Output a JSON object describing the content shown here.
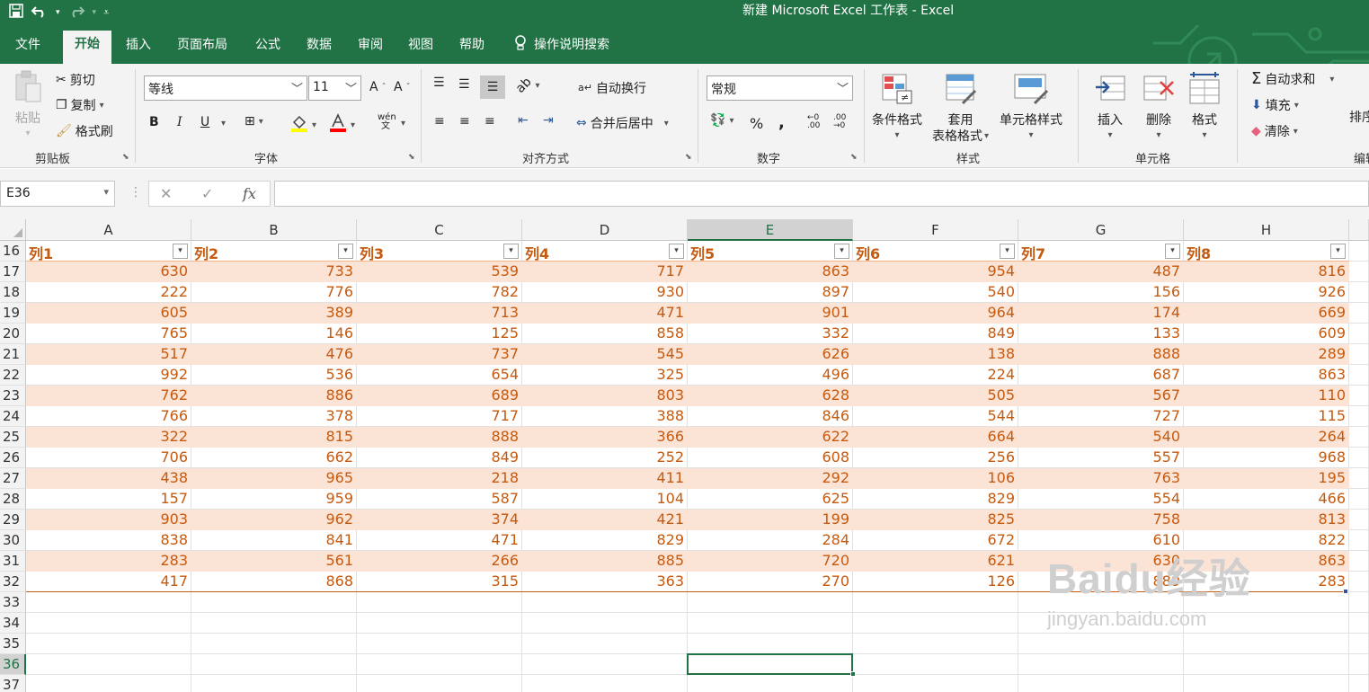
{
  "title": "新建 Microsoft Excel 工作表  -  Excel",
  "qat": {
    "save_icon": "save-icon",
    "undo_icon": "undo-icon",
    "redo_icon": "redo-icon",
    "customize_icon": "customize-icon"
  },
  "tabs": [
    {
      "label": "文件"
    },
    {
      "label": "开始"
    },
    {
      "label": "插入"
    },
    {
      "label": "页面布局"
    },
    {
      "label": "公式"
    },
    {
      "label": "数据"
    },
    {
      "label": "审阅"
    },
    {
      "label": "视图"
    },
    {
      "label": "帮助"
    },
    {
      "label": "操作说明搜索"
    }
  ],
  "ribbon": {
    "clipboard": {
      "paste": "粘贴",
      "cut": "剪切",
      "copy": "复制",
      "format_painter": "格式刷",
      "label": "剪贴板"
    },
    "font": {
      "name": "等线",
      "size": "11",
      "bold": "B",
      "italic": "I",
      "underline": "U",
      "grow": "A",
      "shrink": "A",
      "phonetic": "wén 文",
      "label": "字体"
    },
    "alignment": {
      "wrap": "自动换行",
      "merge": "合并后居中",
      "label": "对齐方式"
    },
    "number": {
      "format": "常规",
      "percent": "%",
      "comma": ",",
      "label": "数字"
    },
    "styles": {
      "conditional": "条件格式",
      "table_1": "套用",
      "table_2": "表格格式",
      "cell_styles": "单元格样式",
      "label": "样式"
    },
    "cells": {
      "insert": "插入",
      "delete": "删除",
      "format": "格式",
      "label": "单元格"
    },
    "editing": {
      "autosum": "自动求和",
      "fill": "填充",
      "clear": "清除",
      "sort": "排序",
      "label": "编辑"
    }
  },
  "formula_bar": {
    "name_box": "E36",
    "cancel": "✕",
    "enter": "✓",
    "fx": "fx",
    "value": ""
  },
  "columns": [
    "A",
    "B",
    "C",
    "D",
    "E",
    "F",
    "G",
    "H"
  ],
  "selected_column": "E",
  "selected_row": "36",
  "table": {
    "header_row": "16",
    "headers": [
      "列1",
      "列2",
      "列3",
      "列4",
      "列5",
      "列6",
      "列7",
      "列8"
    ],
    "rows": [
      {
        "num": "17",
        "values": [
          "630",
          "733",
          "539",
          "717",
          "863",
          "954",
          "487",
          "816"
        ]
      },
      {
        "num": "18",
        "values": [
          "222",
          "776",
          "782",
          "930",
          "897",
          "540",
          "156",
          "926"
        ]
      },
      {
        "num": "19",
        "values": [
          "605",
          "389",
          "713",
          "471",
          "901",
          "964",
          "174",
          "669"
        ]
      },
      {
        "num": "20",
        "values": [
          "765",
          "146",
          "125",
          "858",
          "332",
          "849",
          "133",
          "609"
        ]
      },
      {
        "num": "21",
        "values": [
          "517",
          "476",
          "737",
          "545",
          "626",
          "138",
          "888",
          "289"
        ]
      },
      {
        "num": "22",
        "values": [
          "992",
          "536",
          "654",
          "325",
          "496",
          "224",
          "687",
          "863"
        ]
      },
      {
        "num": "23",
        "values": [
          "762",
          "886",
          "689",
          "803",
          "628",
          "505",
          "567",
          "110"
        ]
      },
      {
        "num": "24",
        "values": [
          "766",
          "378",
          "717",
          "388",
          "846",
          "544",
          "727",
          "115"
        ]
      },
      {
        "num": "25",
        "values": [
          "322",
          "815",
          "888",
          "366",
          "622",
          "664",
          "540",
          "264"
        ]
      },
      {
        "num": "26",
        "values": [
          "706",
          "662",
          "849",
          "252",
          "608",
          "256",
          "557",
          "968"
        ]
      },
      {
        "num": "27",
        "values": [
          "438",
          "965",
          "218",
          "411",
          "292",
          "106",
          "763",
          "195"
        ]
      },
      {
        "num": "28",
        "values": [
          "157",
          "959",
          "587",
          "104",
          "625",
          "829",
          "554",
          "466"
        ]
      },
      {
        "num": "29",
        "values": [
          "903",
          "962",
          "374",
          "421",
          "199",
          "825",
          "758",
          "813"
        ]
      },
      {
        "num": "30",
        "values": [
          "838",
          "841",
          "471",
          "829",
          "284",
          "672",
          "610",
          "822"
        ]
      },
      {
        "num": "31",
        "values": [
          "283",
          "561",
          "266",
          "885",
          "720",
          "621",
          "630",
          "863"
        ]
      },
      {
        "num": "32",
        "values": [
          "417",
          "868",
          "315",
          "363",
          "270",
          "126",
          "889",
          "283"
        ]
      }
    ]
  },
  "empty_rows": [
    "33",
    "34",
    "35",
    "36",
    "37"
  ],
  "watermark": {
    "logo": "Baidu经验",
    "url": "jingyan.baidu.com"
  },
  "colors": {
    "excel_green": "#217346",
    "table_accent": "#c55a11",
    "band": "#fbe4d5"
  }
}
